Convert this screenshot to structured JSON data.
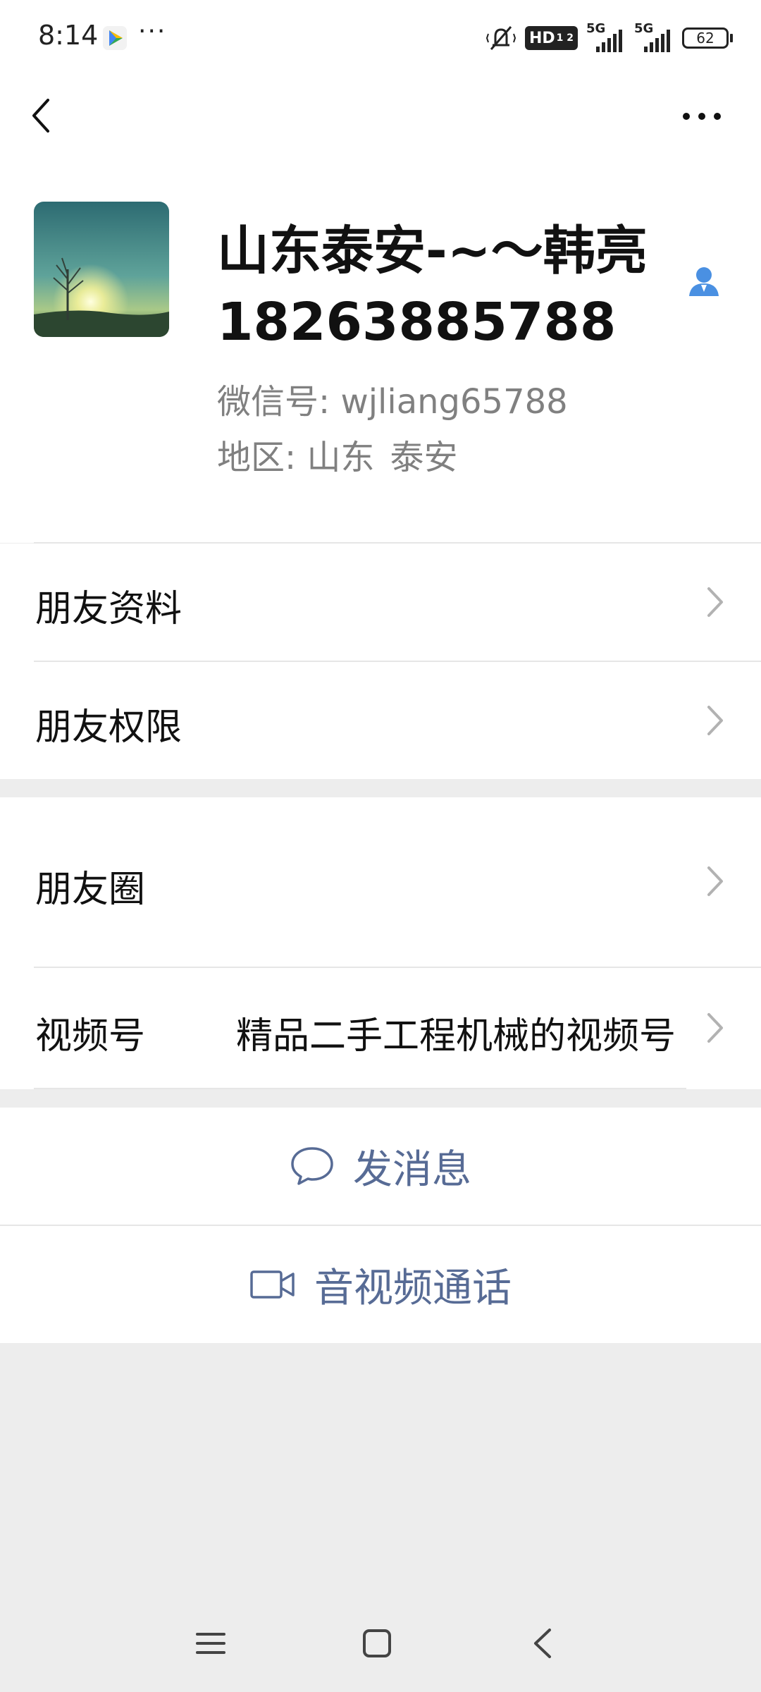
{
  "status_bar": {
    "time": "8:14",
    "dots": "···",
    "network_1": "5G",
    "network_2": "5G",
    "hd": "HD",
    "battery": "62",
    "icons": [
      "play-store-icon",
      "silent-vibrate-icon",
      "hd-voice-icon",
      "signal-icon",
      "battery-icon"
    ]
  },
  "header": {
    "back_icon": "chevron-left-icon",
    "more_icon": "more-icon"
  },
  "profile": {
    "nickname": "山东泰安-~～韩亮",
    "phone": "18263885788",
    "wechat_id_label": "微信号: ",
    "wechat_id": "wjliang65788",
    "region_label": "地区: ",
    "region_province": "山东",
    "region_city": "泰安",
    "contact_icon": "contact-person-icon"
  },
  "menu": {
    "friend_info": "朋友资料",
    "friend_permissions": "朋友权限",
    "moments": "朋友圈",
    "channels": "视频号",
    "channels_value": "精品二手工程机械的视频号"
  },
  "actions": {
    "send_message": "发消息",
    "video_call": "音视频通话"
  },
  "colors": {
    "accent": "#576b95",
    "contact_icon": "#4a90e2",
    "background": "#ededed"
  }
}
